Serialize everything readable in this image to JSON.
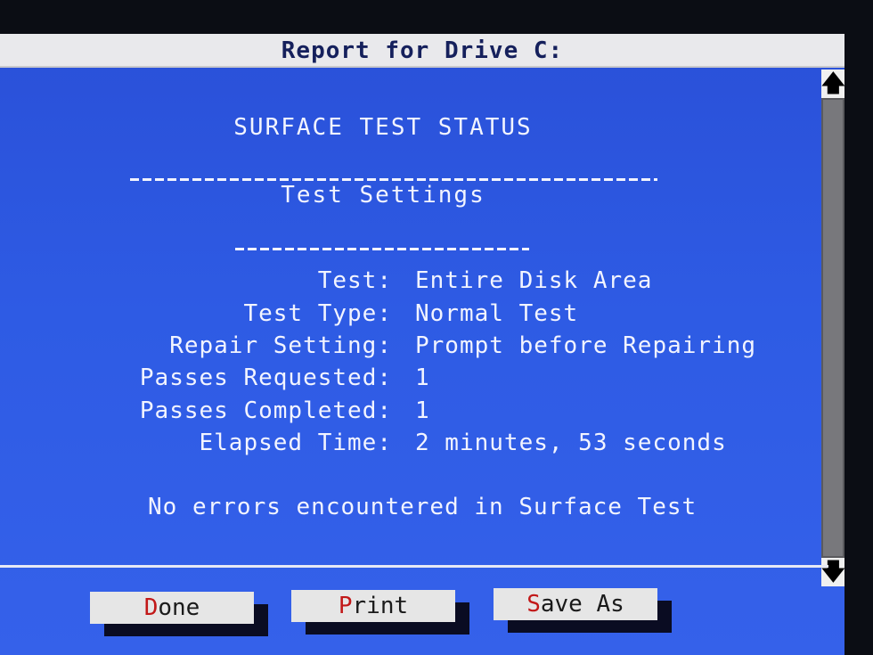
{
  "window": {
    "title": "Report for Drive C:"
  },
  "report": {
    "heading": "SURFACE TEST STATUS",
    "subheading": "Test Settings",
    "rows": [
      {
        "label": "Test:",
        "value": "Entire Disk Area"
      },
      {
        "label": "Test Type:",
        "value": "Normal Test"
      },
      {
        "label": "Repair Setting:",
        "value": "Prompt before Repairing"
      },
      {
        "label": "Passes Requested:",
        "value": "1"
      },
      {
        "label": "Passes Completed:",
        "value": "1"
      },
      {
        "label": "Elapsed Time:",
        "value": "2 minutes, 53 seconds"
      }
    ],
    "message": "No errors encountered in Surface Test"
  },
  "scrollbar": {
    "up_glyph": "🡅",
    "down_glyph": "🡇",
    "up_icon": "arrow-up-icon",
    "down_icon": "arrow-down-icon"
  },
  "buttons": {
    "done": {
      "hotkey": "D",
      "rest": "one"
    },
    "print": {
      "hotkey": "P",
      "rest": "rint"
    },
    "save_as": {
      "hotkey": "S",
      "rest": "ave As"
    }
  },
  "colors": {
    "background": "#2e5be4",
    "text": "#f2f4ff",
    "hotkey": "#c21818",
    "button": "#e6e6e6"
  }
}
